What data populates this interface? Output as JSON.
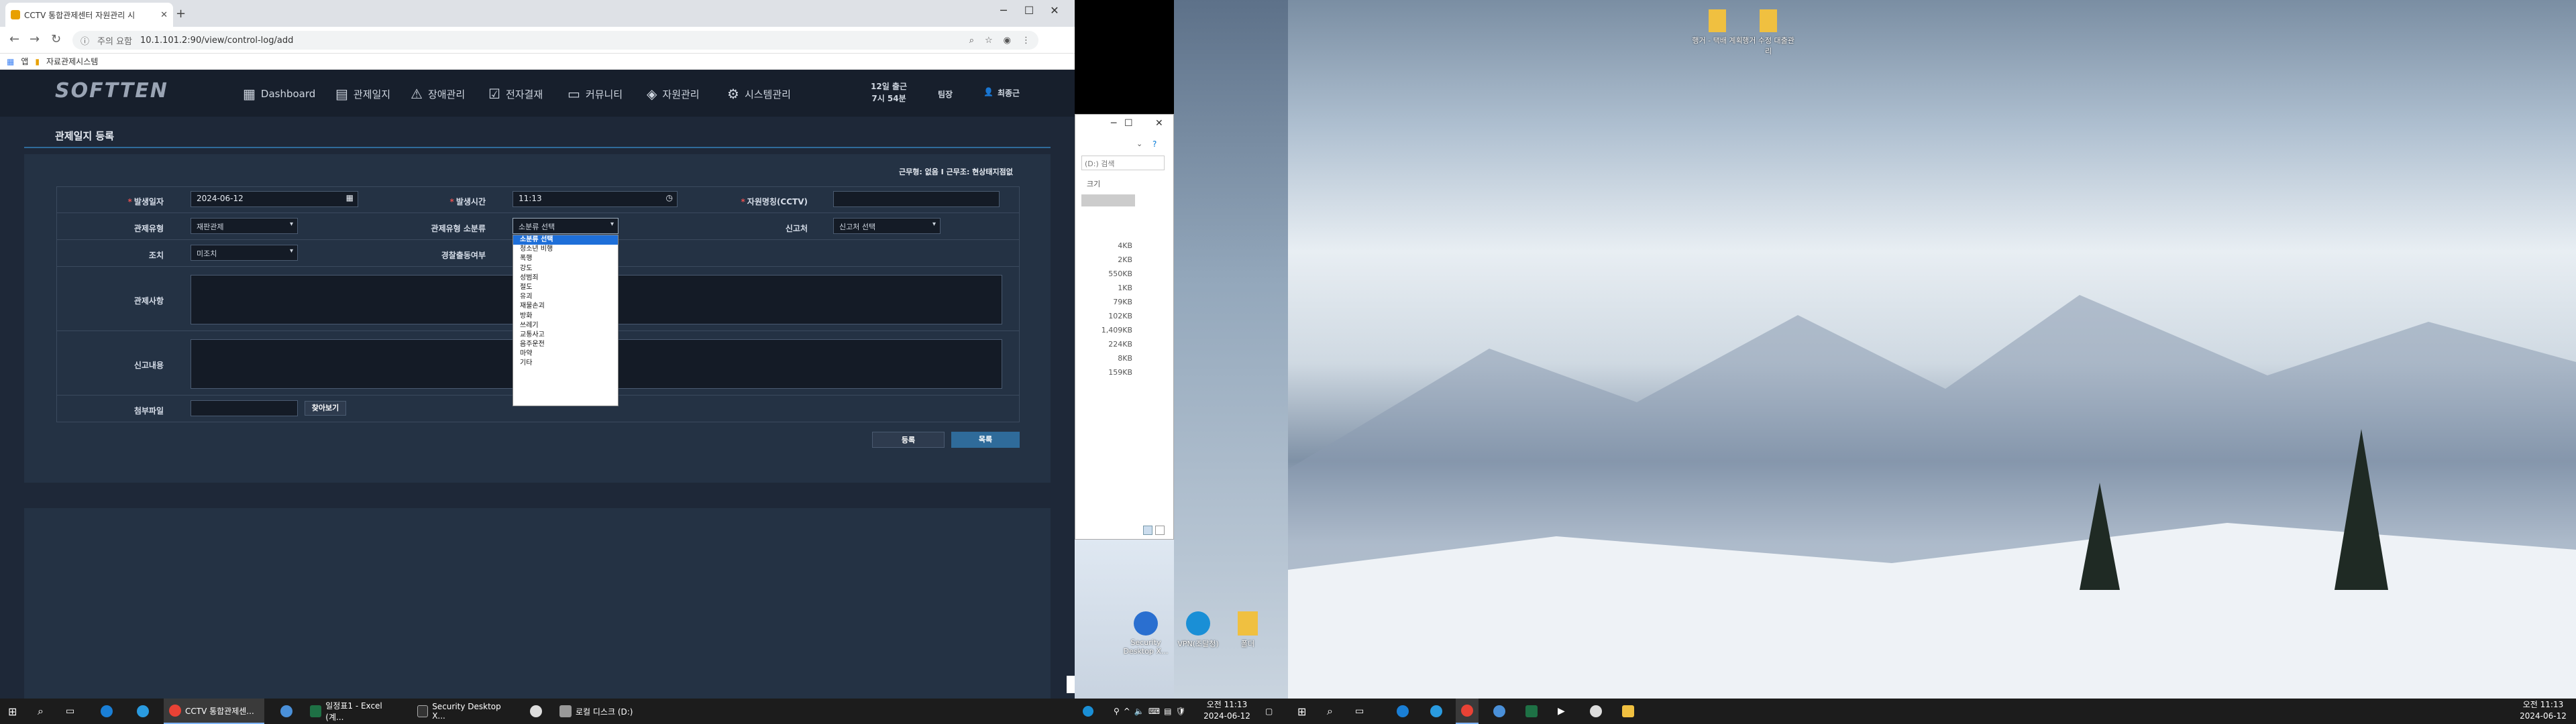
{
  "browser": {
    "tab_title": "CCTV 통합관제센터 자원관리 시",
    "address_warning": "주의 요함",
    "url": "10.1.101.2:90/view/control-log/add",
    "bookmarks": [
      "앱",
      "자료관제시스템"
    ]
  },
  "app": {
    "logo": "SOFTTEN",
    "menu": [
      {
        "label": "Dashboard",
        "icon": "grid-icon"
      },
      {
        "label": "관제일지",
        "icon": "document-icon"
      },
      {
        "label": "장애관리",
        "icon": "warning-icon"
      },
      {
        "label": "전자결재",
        "icon": "check-icon"
      },
      {
        "label": "커뮤니티",
        "icon": "chat-icon"
      },
      {
        "label": "자원관리",
        "icon": "box-icon"
      },
      {
        "label": "시스템관리",
        "icon": "gear-icon"
      }
    ],
    "shift_line1": "12일 출근",
    "shift_line2": "7시 54분",
    "role": "팀장",
    "user_name": "최종근",
    "page_title": "관제일지 등록",
    "duty_info": "근무형: 없음  I  근무조: 현상태지점없",
    "form": {
      "occur_date_label": "발생일자",
      "occur_date_value": "2024-06-12",
      "occur_time_label": "발생시간",
      "occur_time_value": "11:13",
      "cctv_label": "자원명칭(CCTV)",
      "control_type_label": "관제유형",
      "control_type_value": "재판관제",
      "subtype_label": "관제유형 소분류",
      "subtype_value": "소분류 선택",
      "reporter_label": "신고처",
      "reporter_value": "신고처 선택",
      "action_label": "조치",
      "action_value": "미조치",
      "police_label": "경찰출동여부",
      "details_label": "관제사항",
      "report_label": "신고내용",
      "attach_label": "첨부파일",
      "browse_button": "찾아보기",
      "register_button": "등록",
      "list_button": "목록"
    },
    "dropdown_options": [
      "소분류 선택",
      "청소년 비행",
      "폭행",
      "강도",
      "성범죄",
      "절도",
      "유괴",
      "재물손괴",
      "방화",
      "쓰레기",
      "교통사고",
      "음주운전",
      "마약",
      "기타"
    ]
  },
  "explorer": {
    "search_placeholder": "(D:) 검색",
    "size_header": "크기",
    "sizes": [
      "4KB",
      "2KB",
      "550KB",
      "1KB",
      "79KB",
      "102KB",
      "1,409KB",
      "224KB",
      "8KB",
      "159KB"
    ]
  },
  "desktop": {
    "left_icons": [
      "Security Desktop X...",
      "VPN(조달청)",
      "폴더"
    ],
    "right_icons": [
      "행거 - 택배 계획",
      "행거 수정 대출관리"
    ]
  },
  "taskbar": {
    "items": [
      "CCTV 통합관제센...",
      "일정표1 - Excel (계...",
      "Security Desktop X...",
      "로컬 디스크 (D:)"
    ],
    "time": "오전 11:13",
    "date": "2024-06-12",
    "time2": "오전 11:13",
    "date2": "2024-06-12"
  }
}
